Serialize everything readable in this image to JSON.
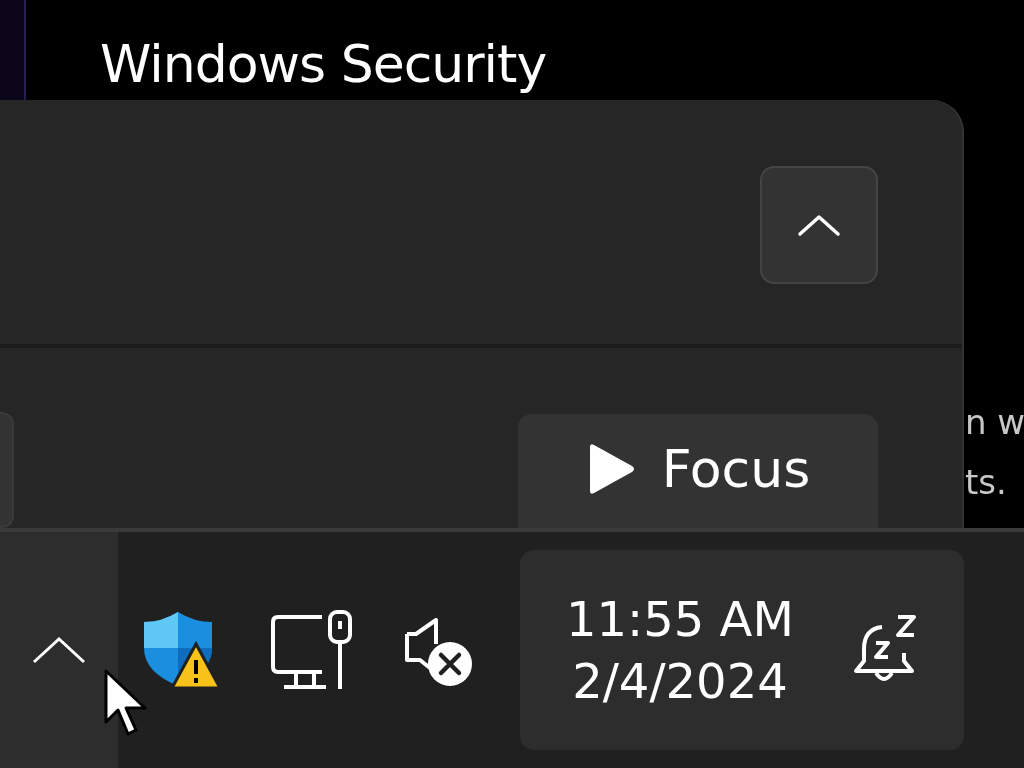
{
  "background": {
    "title": "Windows Security",
    "text_lines": [
      "n w",
      "ts."
    ]
  },
  "flyout": {
    "focus_button": {
      "label": "Focus"
    }
  },
  "taskbar": {
    "overflow_hovered": true,
    "tray_icons": [
      {
        "kind": "shield-warning"
      },
      {
        "kind": "wired-network"
      },
      {
        "kind": "speaker-muted"
      }
    ],
    "clock": {
      "time": "11:55 AM",
      "date": "2/4/2024"
    },
    "notifications": {
      "do_not_disturb": true
    }
  }
}
